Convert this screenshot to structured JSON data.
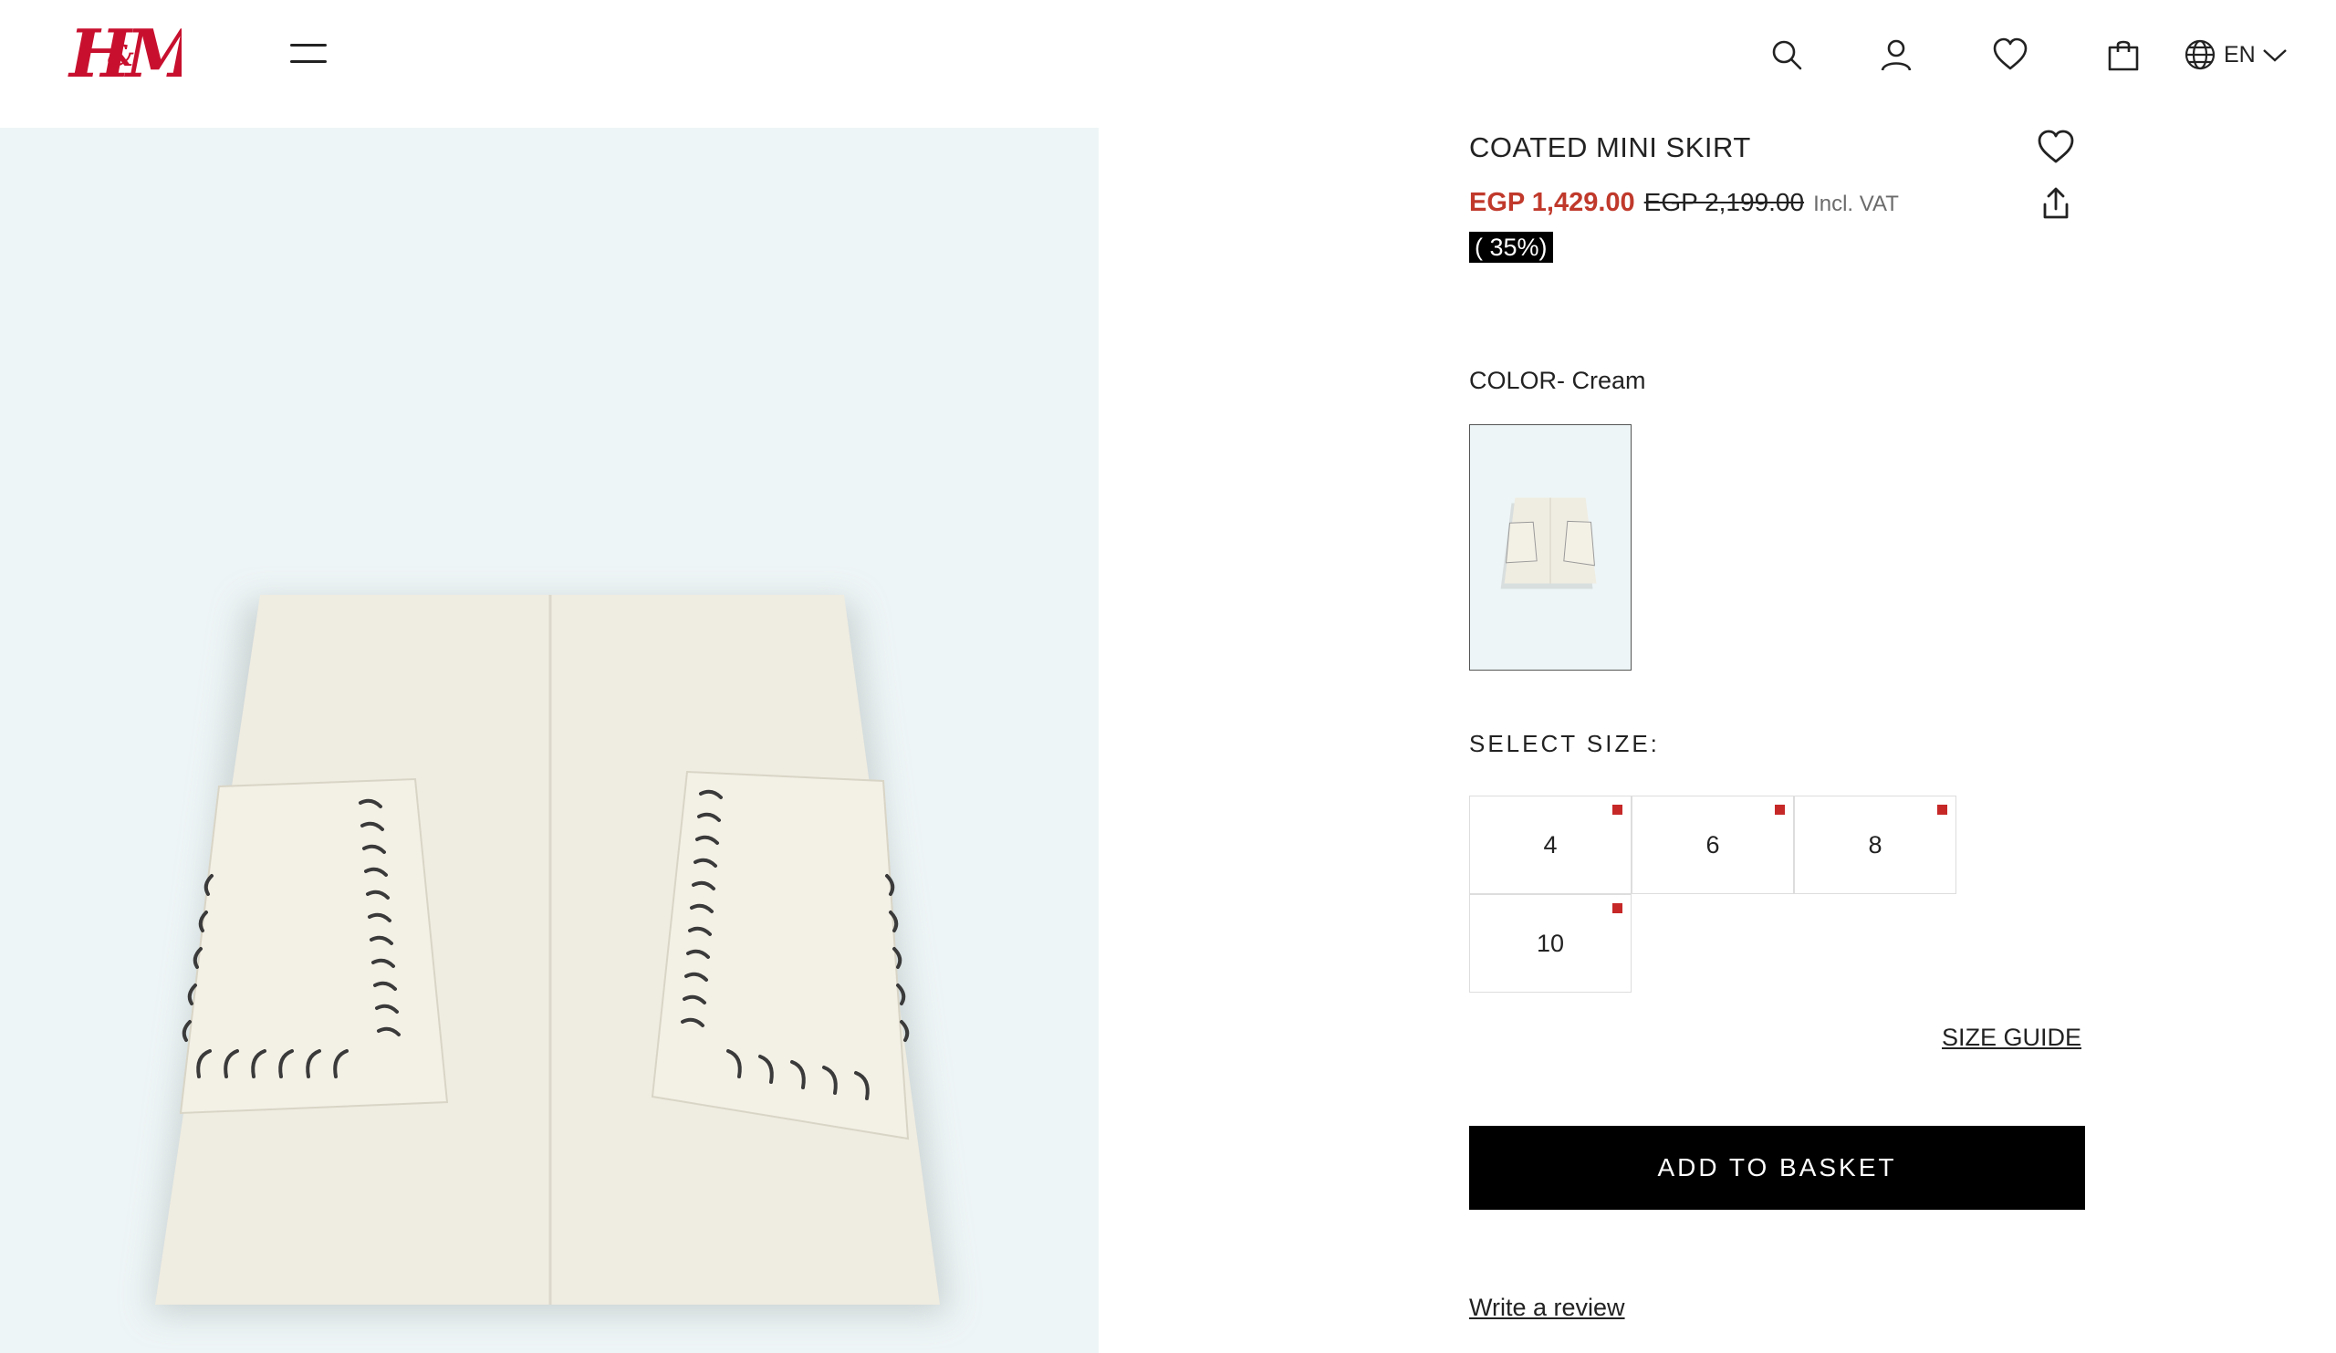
{
  "header": {
    "brand": "H&M",
    "lang": "EN"
  },
  "product": {
    "title": "COATED MINI SKIRT",
    "price_sale": "EGP 1,429.00",
    "price_original": "EGP 2,199.00",
    "vat_note": "Incl. VAT",
    "discount": "( 35%)",
    "color_label": "COLOR- Cream",
    "select_size_label": "SELECT SIZE:",
    "sizes": [
      "4",
      "6",
      "8",
      "10"
    ],
    "size_guide": "SIZE GUIDE",
    "add_to_basket": "ADD TO BASKET",
    "write_review": "Write a review"
  },
  "colors": {
    "sale_price": "#c0392b",
    "low_stock_dot": "#c62828",
    "image_background": "#eef5f6",
    "button_background": "#000000"
  },
  "icons": [
    "menu-icon",
    "search-icon",
    "account-icon",
    "heart-icon",
    "shopping-bag-icon",
    "globe-icon",
    "chevron-down-icon",
    "share-icon"
  ]
}
